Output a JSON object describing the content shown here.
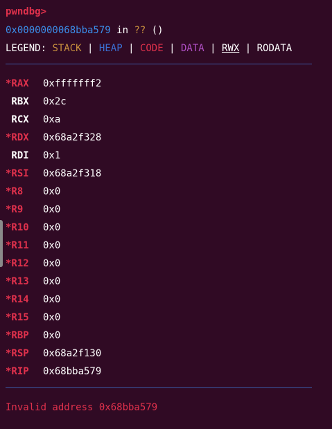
{
  "prompt": "pwndbg>",
  "location": {
    "address": "0x0000000068bba579",
    "in_word": "in",
    "symbol": "??",
    "args": "()"
  },
  "legend": {
    "label": "LEGEND:",
    "items": [
      "STACK",
      "HEAP",
      "CODE",
      "DATA",
      "RWX",
      "RODATA"
    ],
    "separator": "|"
  },
  "registers": [
    {
      "name": "*RAX",
      "value": "0xfffffff2",
      "changed": true
    },
    {
      "name": " RBX",
      "value": "0x2c",
      "changed": false
    },
    {
      "name": " RCX",
      "value": "0xa",
      "changed": false
    },
    {
      "name": "*RDX",
      "value": "0x68a2f328",
      "changed": true
    },
    {
      "name": " RDI",
      "value": "0x1",
      "changed": false
    },
    {
      "name": "*RSI",
      "value": "0x68a2f318",
      "changed": true
    },
    {
      "name": "*R8",
      "value": "0x0",
      "changed": true
    },
    {
      "name": "*R9",
      "value": "0x0",
      "changed": true
    },
    {
      "name": "*R10",
      "value": "0x0",
      "changed": true
    },
    {
      "name": "*R11",
      "value": "0x0",
      "changed": true
    },
    {
      "name": "*R12",
      "value": "0x0",
      "changed": true
    },
    {
      "name": "*R13",
      "value": "0x0",
      "changed": true
    },
    {
      "name": "*R14",
      "value": "0x0",
      "changed": true
    },
    {
      "name": "*R15",
      "value": "0x0",
      "changed": true
    },
    {
      "name": "*RBP",
      "value": "0x0",
      "changed": true
    },
    {
      "name": "*RSP",
      "value": "0x68a2f130",
      "changed": true
    },
    {
      "name": "*RIP",
      "value": "0x68bba579",
      "changed": true
    }
  ],
  "error_message": "Invalid address 0x68bba579",
  "colors": {
    "background": "#300a24",
    "prompt": "#e0314c",
    "address": "#3b8eea",
    "stack": "#c78f3e",
    "heap": "#3b6fd1",
    "code": "#e0314c",
    "data": "#b04fc4",
    "separator": "#3a5aa8"
  }
}
